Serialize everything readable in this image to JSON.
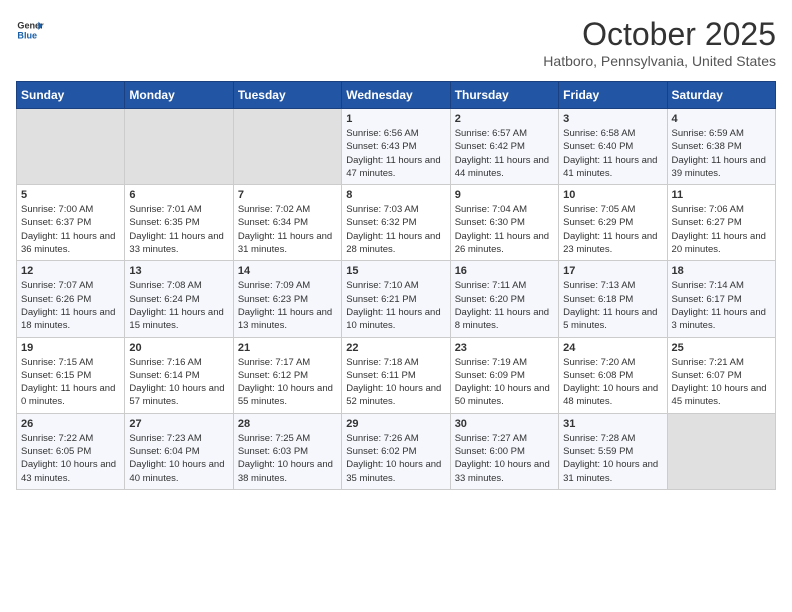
{
  "header": {
    "logo_line1": "General",
    "logo_line2": "Blue",
    "month": "October 2025",
    "location": "Hatboro, Pennsylvania, United States"
  },
  "weekdays": [
    "Sunday",
    "Monday",
    "Tuesday",
    "Wednesday",
    "Thursday",
    "Friday",
    "Saturday"
  ],
  "weeks": [
    [
      {
        "day": "",
        "sunrise": "",
        "sunset": "",
        "daylight": ""
      },
      {
        "day": "",
        "sunrise": "",
        "sunset": "",
        "daylight": ""
      },
      {
        "day": "",
        "sunrise": "",
        "sunset": "",
        "daylight": ""
      },
      {
        "day": "1",
        "sunrise": "Sunrise: 6:56 AM",
        "sunset": "Sunset: 6:43 PM",
        "daylight": "Daylight: 11 hours and 47 minutes."
      },
      {
        "day": "2",
        "sunrise": "Sunrise: 6:57 AM",
        "sunset": "Sunset: 6:42 PM",
        "daylight": "Daylight: 11 hours and 44 minutes."
      },
      {
        "day": "3",
        "sunrise": "Sunrise: 6:58 AM",
        "sunset": "Sunset: 6:40 PM",
        "daylight": "Daylight: 11 hours and 41 minutes."
      },
      {
        "day": "4",
        "sunrise": "Sunrise: 6:59 AM",
        "sunset": "Sunset: 6:38 PM",
        "daylight": "Daylight: 11 hours and 39 minutes."
      }
    ],
    [
      {
        "day": "5",
        "sunrise": "Sunrise: 7:00 AM",
        "sunset": "Sunset: 6:37 PM",
        "daylight": "Daylight: 11 hours and 36 minutes."
      },
      {
        "day": "6",
        "sunrise": "Sunrise: 7:01 AM",
        "sunset": "Sunset: 6:35 PM",
        "daylight": "Daylight: 11 hours and 33 minutes."
      },
      {
        "day": "7",
        "sunrise": "Sunrise: 7:02 AM",
        "sunset": "Sunset: 6:34 PM",
        "daylight": "Daylight: 11 hours and 31 minutes."
      },
      {
        "day": "8",
        "sunrise": "Sunrise: 7:03 AM",
        "sunset": "Sunset: 6:32 PM",
        "daylight": "Daylight: 11 hours and 28 minutes."
      },
      {
        "day": "9",
        "sunrise": "Sunrise: 7:04 AM",
        "sunset": "Sunset: 6:30 PM",
        "daylight": "Daylight: 11 hours and 26 minutes."
      },
      {
        "day": "10",
        "sunrise": "Sunrise: 7:05 AM",
        "sunset": "Sunset: 6:29 PM",
        "daylight": "Daylight: 11 hours and 23 minutes."
      },
      {
        "day": "11",
        "sunrise": "Sunrise: 7:06 AM",
        "sunset": "Sunset: 6:27 PM",
        "daylight": "Daylight: 11 hours and 20 minutes."
      }
    ],
    [
      {
        "day": "12",
        "sunrise": "Sunrise: 7:07 AM",
        "sunset": "Sunset: 6:26 PM",
        "daylight": "Daylight: 11 hours and 18 minutes."
      },
      {
        "day": "13",
        "sunrise": "Sunrise: 7:08 AM",
        "sunset": "Sunset: 6:24 PM",
        "daylight": "Daylight: 11 hours and 15 minutes."
      },
      {
        "day": "14",
        "sunrise": "Sunrise: 7:09 AM",
        "sunset": "Sunset: 6:23 PM",
        "daylight": "Daylight: 11 hours and 13 minutes."
      },
      {
        "day": "15",
        "sunrise": "Sunrise: 7:10 AM",
        "sunset": "Sunset: 6:21 PM",
        "daylight": "Daylight: 11 hours and 10 minutes."
      },
      {
        "day": "16",
        "sunrise": "Sunrise: 7:11 AM",
        "sunset": "Sunset: 6:20 PM",
        "daylight": "Daylight: 11 hours and 8 minutes."
      },
      {
        "day": "17",
        "sunrise": "Sunrise: 7:13 AM",
        "sunset": "Sunset: 6:18 PM",
        "daylight": "Daylight: 11 hours and 5 minutes."
      },
      {
        "day": "18",
        "sunrise": "Sunrise: 7:14 AM",
        "sunset": "Sunset: 6:17 PM",
        "daylight": "Daylight: 11 hours and 3 minutes."
      }
    ],
    [
      {
        "day": "19",
        "sunrise": "Sunrise: 7:15 AM",
        "sunset": "Sunset: 6:15 PM",
        "daylight": "Daylight: 11 hours and 0 minutes."
      },
      {
        "day": "20",
        "sunrise": "Sunrise: 7:16 AM",
        "sunset": "Sunset: 6:14 PM",
        "daylight": "Daylight: 10 hours and 57 minutes."
      },
      {
        "day": "21",
        "sunrise": "Sunrise: 7:17 AM",
        "sunset": "Sunset: 6:12 PM",
        "daylight": "Daylight: 10 hours and 55 minutes."
      },
      {
        "day": "22",
        "sunrise": "Sunrise: 7:18 AM",
        "sunset": "Sunset: 6:11 PM",
        "daylight": "Daylight: 10 hours and 52 minutes."
      },
      {
        "day": "23",
        "sunrise": "Sunrise: 7:19 AM",
        "sunset": "Sunset: 6:09 PM",
        "daylight": "Daylight: 10 hours and 50 minutes."
      },
      {
        "day": "24",
        "sunrise": "Sunrise: 7:20 AM",
        "sunset": "Sunset: 6:08 PM",
        "daylight": "Daylight: 10 hours and 48 minutes."
      },
      {
        "day": "25",
        "sunrise": "Sunrise: 7:21 AM",
        "sunset": "Sunset: 6:07 PM",
        "daylight": "Daylight: 10 hours and 45 minutes."
      }
    ],
    [
      {
        "day": "26",
        "sunrise": "Sunrise: 7:22 AM",
        "sunset": "Sunset: 6:05 PM",
        "daylight": "Daylight: 10 hours and 43 minutes."
      },
      {
        "day": "27",
        "sunrise": "Sunrise: 7:23 AM",
        "sunset": "Sunset: 6:04 PM",
        "daylight": "Daylight: 10 hours and 40 minutes."
      },
      {
        "day": "28",
        "sunrise": "Sunrise: 7:25 AM",
        "sunset": "Sunset: 6:03 PM",
        "daylight": "Daylight: 10 hours and 38 minutes."
      },
      {
        "day": "29",
        "sunrise": "Sunrise: 7:26 AM",
        "sunset": "Sunset: 6:02 PM",
        "daylight": "Daylight: 10 hours and 35 minutes."
      },
      {
        "day": "30",
        "sunrise": "Sunrise: 7:27 AM",
        "sunset": "Sunset: 6:00 PM",
        "daylight": "Daylight: 10 hours and 33 minutes."
      },
      {
        "day": "31",
        "sunrise": "Sunrise: 7:28 AM",
        "sunset": "Sunset: 5:59 PM",
        "daylight": "Daylight: 10 hours and 31 minutes."
      },
      {
        "day": "",
        "sunrise": "",
        "sunset": "",
        "daylight": ""
      }
    ]
  ]
}
